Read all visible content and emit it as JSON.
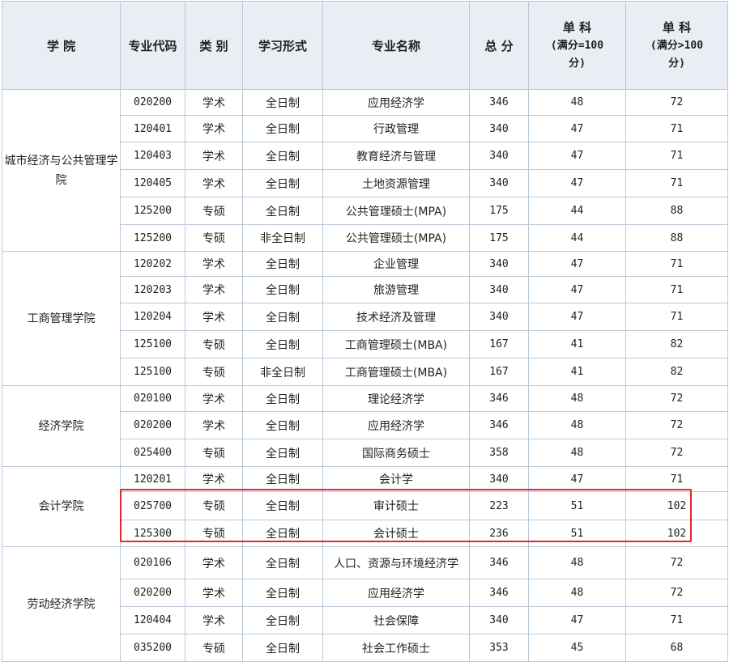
{
  "headers": {
    "college": "学 院",
    "code": "专业代码",
    "category": "类 别",
    "mode": "学习形式",
    "major": "专业名称",
    "total": "总 分",
    "single_100": {
      "title": "单 科",
      "sub1": "(满分=100",
      "sub2": "分)"
    },
    "single_gt100": {
      "title": "单 科",
      "sub1": "(满分>100",
      "sub2": "分)"
    }
  },
  "groups": [
    {
      "college": "城市经济与公共管理学院",
      "rows": [
        {
          "code": "020200",
          "category": "学术",
          "mode": "全日制",
          "major": "应用经济学",
          "total": "346",
          "s100": "48",
          "sgt100": "72"
        },
        {
          "code": "120401",
          "category": "学术",
          "mode": "全日制",
          "major": "行政管理",
          "total": "340",
          "s100": "47",
          "sgt100": "71"
        },
        {
          "code": "120403",
          "category": "学术",
          "mode": "全日制",
          "major": "教育经济与管理",
          "total": "340",
          "s100": "47",
          "sgt100": "71"
        },
        {
          "code": "120405",
          "category": "学术",
          "mode": "全日制",
          "major": "土地资源管理",
          "total": "340",
          "s100": "47",
          "sgt100": "71"
        },
        {
          "code": "125200",
          "category": "专硕",
          "mode": "全日制",
          "major": "公共管理硕士(MPA)",
          "total": "175",
          "s100": "44",
          "sgt100": "88"
        },
        {
          "code": "125200",
          "category": "专硕",
          "mode": "非全日制",
          "major": "公共管理硕士(MPA)",
          "total": "175",
          "s100": "44",
          "sgt100": "88"
        }
      ]
    },
    {
      "college": "工商管理学院",
      "rows": [
        {
          "code": "120202",
          "category": "学术",
          "mode": "全日制",
          "major": "企业管理",
          "total": "340",
          "s100": "47",
          "sgt100": "71"
        },
        {
          "code": "120203",
          "category": "学术",
          "mode": "全日制",
          "major": "旅游管理",
          "total": "340",
          "s100": "47",
          "sgt100": "71"
        },
        {
          "code": "120204",
          "category": "学术",
          "mode": "全日制",
          "major": "技术经济及管理",
          "total": "340",
          "s100": "47",
          "sgt100": "71"
        },
        {
          "code": "125100",
          "category": "专硕",
          "mode": "全日制",
          "major": "工商管理硕士(MBA)",
          "total": "167",
          "s100": "41",
          "sgt100": "82"
        },
        {
          "code": "125100",
          "category": "专硕",
          "mode": "非全日制",
          "major": "工商管理硕士(MBA)",
          "total": "167",
          "s100": "41",
          "sgt100": "82"
        }
      ]
    },
    {
      "college": "经济学院",
      "rows": [
        {
          "code": "020100",
          "category": "学术",
          "mode": "全日制",
          "major": "理论经济学",
          "total": "346",
          "s100": "48",
          "sgt100": "72"
        },
        {
          "code": "020200",
          "category": "学术",
          "mode": "全日制",
          "major": "应用经济学",
          "total": "346",
          "s100": "48",
          "sgt100": "72"
        },
        {
          "code": "025400",
          "category": "专硕",
          "mode": "全日制",
          "major": "国际商务硕士",
          "total": "358",
          "s100": "48",
          "sgt100": "72"
        }
      ]
    },
    {
      "college": "会计学院",
      "rows": [
        {
          "code": "120201",
          "category": "学术",
          "mode": "全日制",
          "major": "会计学",
          "total": "340",
          "s100": "47",
          "sgt100": "71"
        },
        {
          "code": "025700",
          "category": "专硕",
          "mode": "全日制",
          "major": "审计硕士",
          "total": "223",
          "s100": "51",
          "sgt100": "102"
        },
        {
          "code": "125300",
          "category": "专硕",
          "mode": "全日制",
          "major": "会计硕士",
          "total": "236",
          "s100": "51",
          "sgt100": "102"
        }
      ]
    },
    {
      "college": "劳动经济学院",
      "rows": [
        {
          "code": "020106",
          "category": "学术",
          "mode": "全日制",
          "major": "人口、资源与环境经济学",
          "total": "346",
          "s100": "48",
          "sgt100": "72"
        },
        {
          "code": "020200",
          "category": "学术",
          "mode": "全日制",
          "major": "应用经济学",
          "total": "346",
          "s100": "48",
          "sgt100": "72"
        },
        {
          "code": "120404",
          "category": "学术",
          "mode": "全日制",
          "major": "社会保障",
          "total": "340",
          "s100": "47",
          "sgt100": "71"
        },
        {
          "code": "035200",
          "category": "专硕",
          "mode": "全日制",
          "major": "社会工作硕士",
          "total": "353",
          "s100": "45",
          "sgt100": "68"
        }
      ]
    }
  ],
  "highlight_color": "#e8252b"
}
